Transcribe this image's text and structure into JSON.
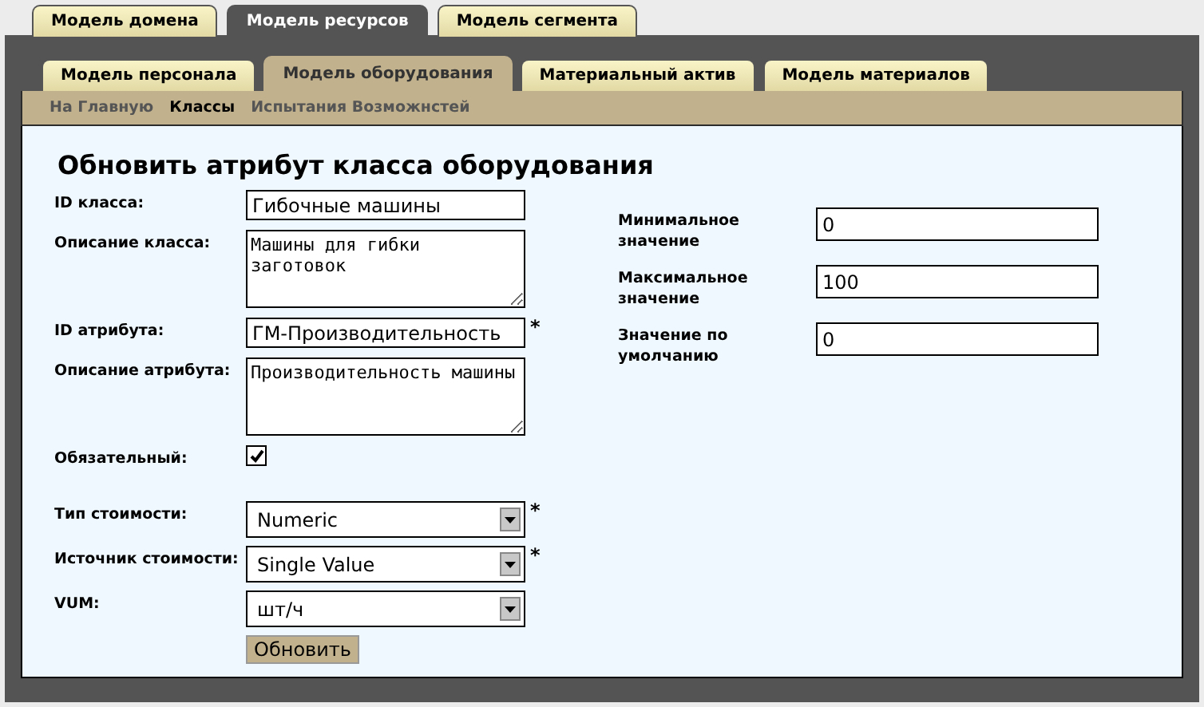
{
  "top_tabs": [
    {
      "label": "Модель домена",
      "selected": false
    },
    {
      "label": "Модель ресурсов",
      "selected": true
    },
    {
      "label": "Модель сегмента",
      "selected": false
    }
  ],
  "sub_tabs": [
    {
      "label": "Модель персонала",
      "selected": false
    },
    {
      "label": "Модель оборудования",
      "selected": true
    },
    {
      "label": "Материальный актив",
      "selected": false
    },
    {
      "label": "Модель материалов",
      "selected": false
    }
  ],
  "nav_links": [
    {
      "label": "На Главную",
      "selected": false
    },
    {
      "label": "Классы",
      "selected": true
    },
    {
      "label": "Испытания Возможнстей",
      "selected": false
    }
  ],
  "title": "Обновить атрибут класса оборудования",
  "left_fields": [
    {
      "kind": "text",
      "label": "ID класса:",
      "value": "Гибочные машины"
    },
    {
      "kind": "textarea",
      "label": "Описание класса:",
      "value": "Машины для гибки заготовок"
    },
    {
      "kind": "text",
      "label": "ID атрибута:",
      "value": "ГМ-Производительность",
      "required_mark": "*"
    },
    {
      "kind": "textarea",
      "label": "Описание атрибута:",
      "value": "Производительность машины"
    },
    {
      "kind": "checkbox",
      "label": "Обязательный:",
      "checked": true
    },
    {
      "kind": "select",
      "label": "Тип стоимости:",
      "value": "Numeric",
      "required_mark": "*"
    },
    {
      "kind": "select",
      "label": "Источник стоимости:",
      "value": "Single Value",
      "required_mark": "*"
    },
    {
      "kind": "select",
      "label": "VUM:",
      "value": "шт/ч"
    }
  ],
  "right_fields": [
    {
      "kind": "text",
      "label": "Минимальное значение",
      "value": "0"
    },
    {
      "kind": "text",
      "label": "Максимальное значение",
      "value": "100"
    },
    {
      "kind": "text",
      "label": "Значение по умолчанию",
      "value": "0"
    }
  ],
  "submit_button": "Обновить"
}
